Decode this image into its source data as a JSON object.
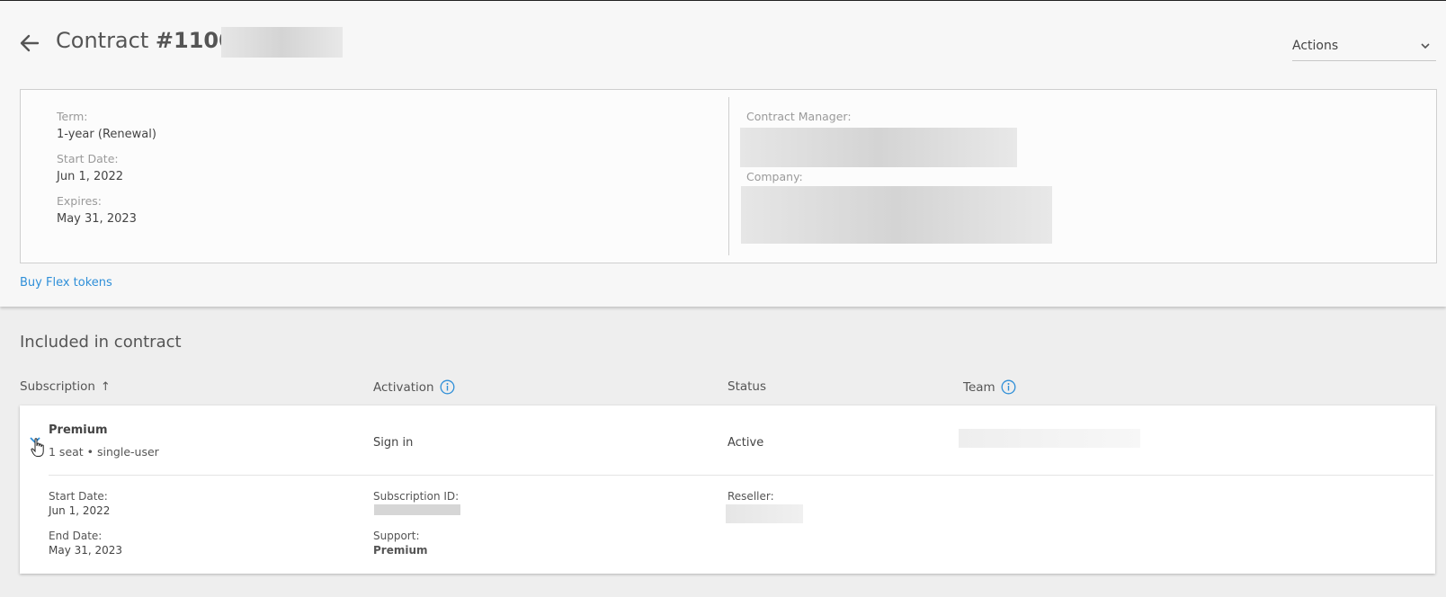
{
  "header": {
    "title_prefix": "Contract",
    "title_number": "#11000",
    "actions_label": "Actions"
  },
  "contract": {
    "term_label": "Term:",
    "term_value": "1-year (Renewal)",
    "start_label": "Start Date:",
    "start_value": "Jun 1, 2022",
    "expires_label": "Expires:",
    "expires_value": "May 31, 2023",
    "manager_label": "Contract Manager:",
    "company_label": "Company:"
  },
  "links": {
    "buy_flex": "Buy Flex tokens"
  },
  "included": {
    "title": "Included in contract",
    "columns": {
      "subscription": "Subscription",
      "activation": "Activation",
      "status": "Status",
      "team": "Team"
    },
    "sort_indicator": "↑",
    "row": {
      "name": "Premium",
      "seats": "1 seat • single-user",
      "activation": "Sign in",
      "status": "Active",
      "start_label": "Start Date:",
      "start_value": "Jun 1, 2022",
      "end_label": "End Date:",
      "end_value": "May 31, 2023",
      "sub_id_label": "Subscription ID:",
      "support_label": "Support:",
      "support_value": "Premium",
      "reseller_label": "Reseller:"
    }
  },
  "colors": {
    "link": "#2f8fd8",
    "info_icon": "#2f8fd8",
    "background": "#eeeeee",
    "panel": "#f7f7f7"
  },
  "icons": {
    "back": "arrow-left-icon",
    "dropdown": "chevron-down-icon",
    "info": "info-icon",
    "expand": "chevron-down-icon",
    "cursor": "hand-pointer-icon"
  }
}
